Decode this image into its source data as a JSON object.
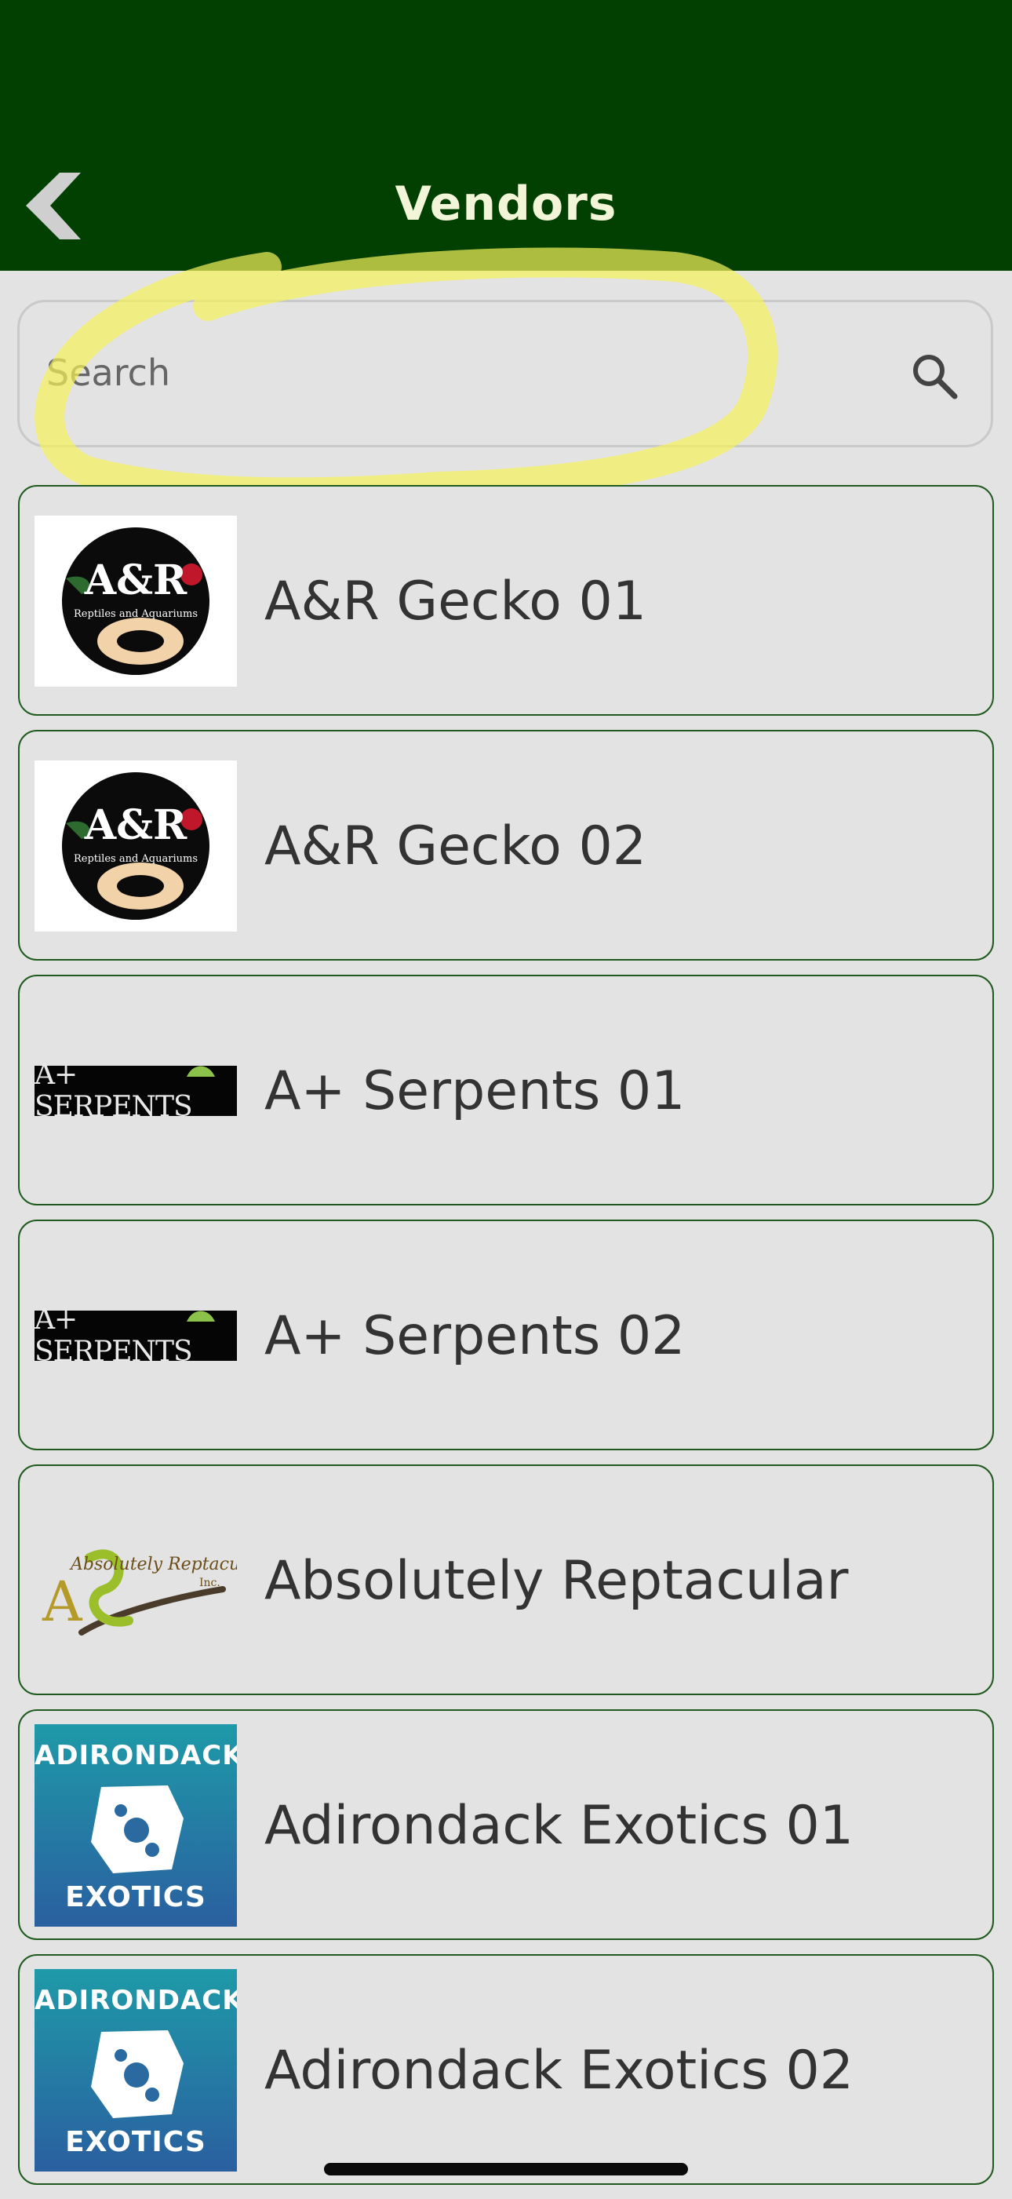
{
  "header": {
    "title": "Vendors",
    "background": "#014001",
    "title_color": "#f2f5d8"
  },
  "search": {
    "placeholder": "Search",
    "icon": "search-icon"
  },
  "vendors": [
    {
      "name": "A&R Gecko 01",
      "logo": "ar-reptiles-logo",
      "logo_text": "A&R",
      "logo_subtext": "Reptiles and Aquariums"
    },
    {
      "name": "A&R Gecko 02",
      "logo": "ar-reptiles-logo",
      "logo_text": "A&R",
      "logo_subtext": "Reptiles and Aquariums"
    },
    {
      "name": "A+ Serpents 01",
      "logo": "a-plus-serpents-logo",
      "logo_text": "A+ SERPENTS"
    },
    {
      "name": "A+ Serpents 02",
      "logo": "a-plus-serpents-logo",
      "logo_text": "A+ SERPENTS"
    },
    {
      "name": "Absolutely Reptacular",
      "logo": "absolutely-reptacular-logo",
      "logo_text": "Absolutely Reptacular",
      "logo_subtext": "Inc."
    },
    {
      "name": "Adirondack Exotics 01",
      "logo": "adirondack-exotics-logo",
      "logo_text": "ADIRONDACK",
      "logo_subtext": "EXOTICS"
    },
    {
      "name": "Adirondack Exotics 02",
      "logo": "adirondack-exotics-logo",
      "logo_text": "ADIRONDACK",
      "logo_subtext": "EXOTICS"
    }
  ],
  "colors": {
    "page_bg": "#e3e3e3",
    "card_border": "#1f5a1f",
    "text": "#333333",
    "highlight": "#f5f25a"
  }
}
